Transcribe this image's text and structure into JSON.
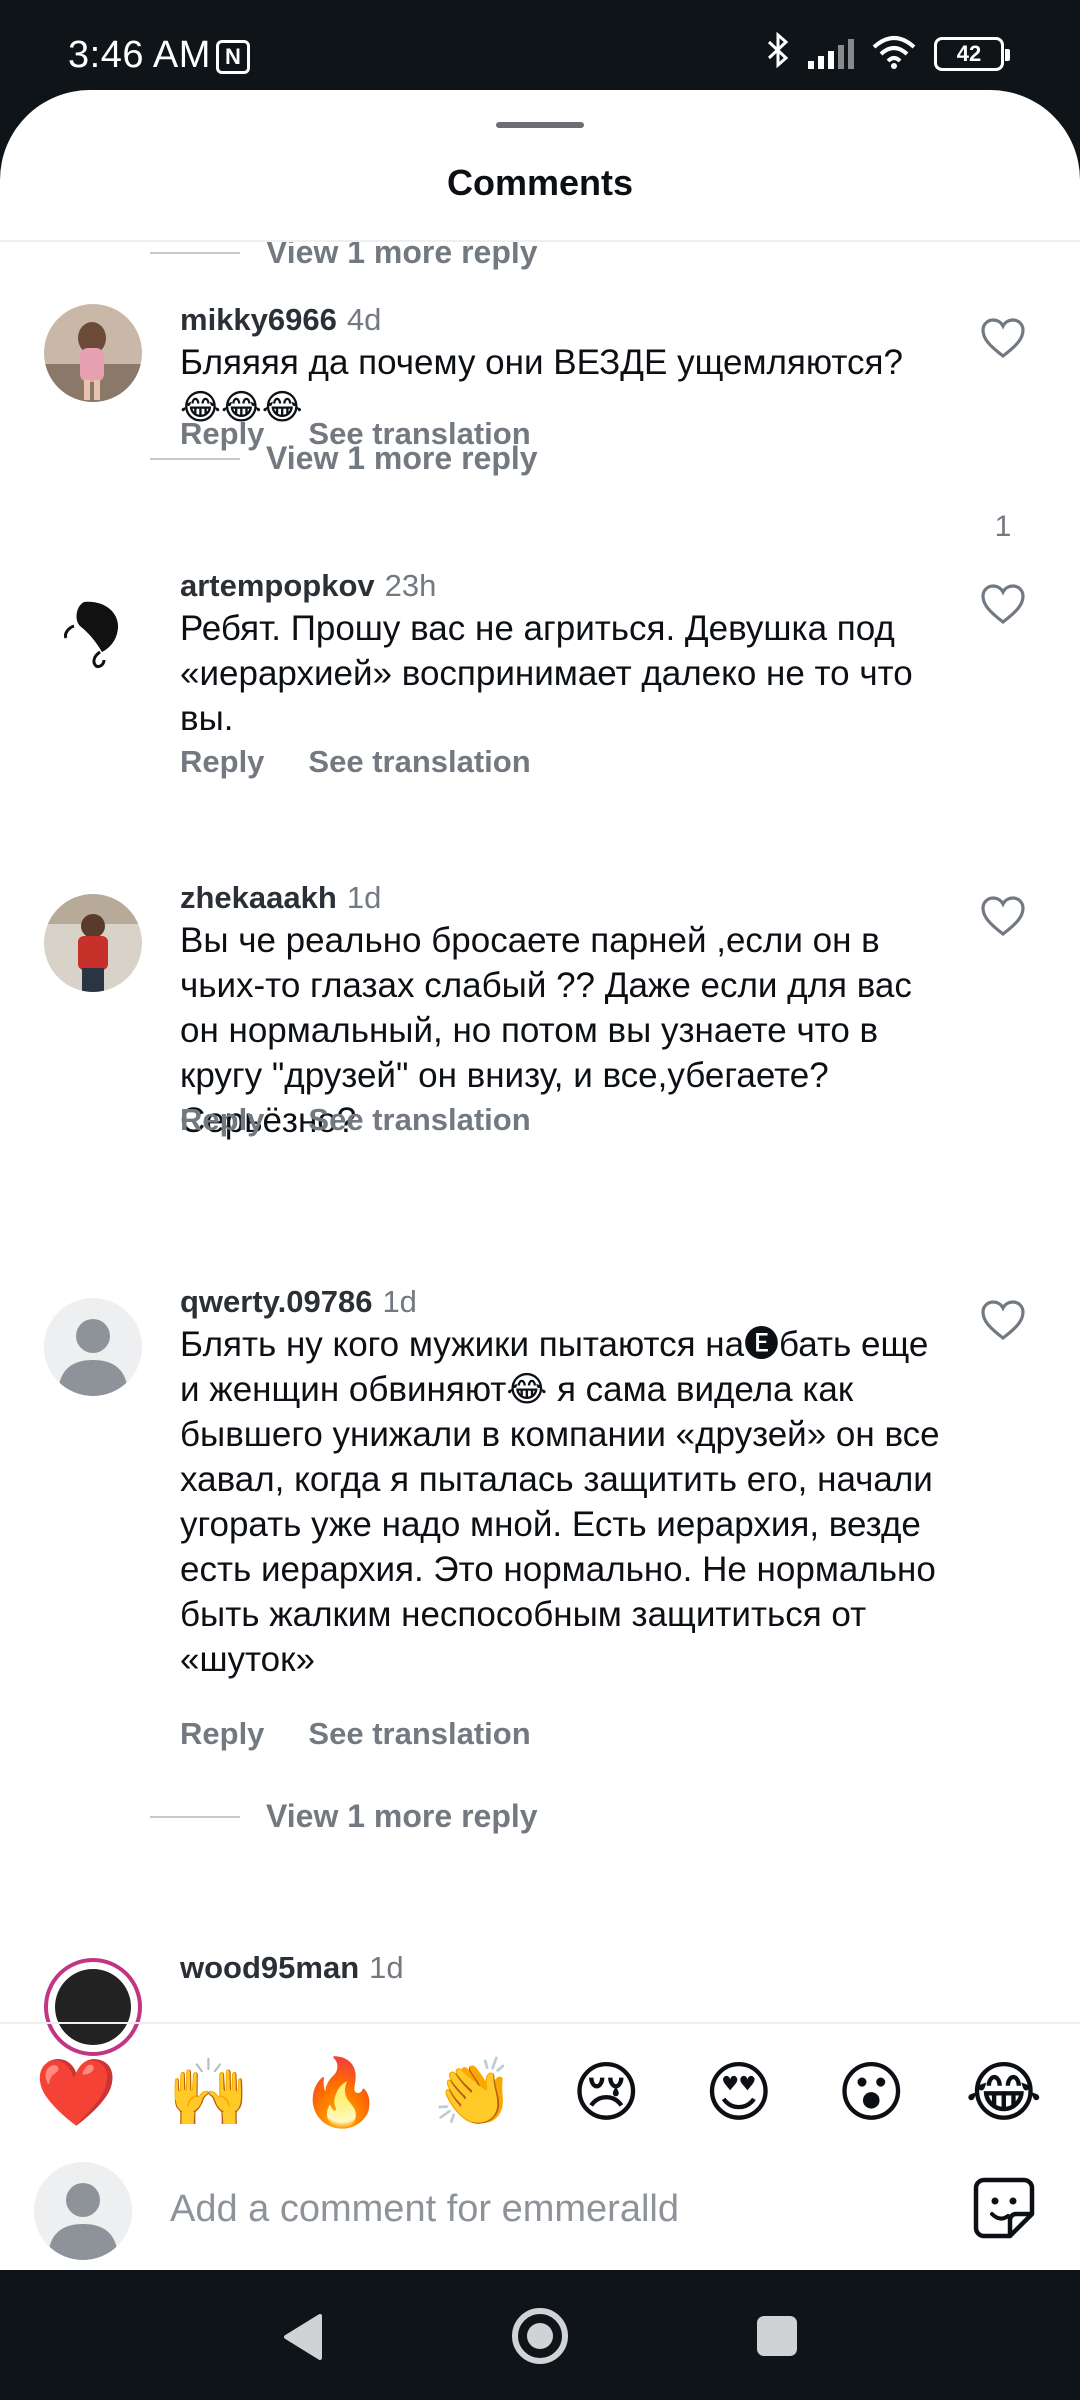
{
  "status_bar": {
    "time": "3:46 AM",
    "nfc_label": "N",
    "battery": "42",
    "icons": [
      "nfc-icon",
      "bluetooth-icon",
      "signal-icon",
      "wifi-icon",
      "battery-icon"
    ]
  },
  "sheet": {
    "title": "Comments"
  },
  "comments": [
    {
      "username": "mikky6966",
      "time": "4d",
      "text": "Бляяяя да почему они ВЕЗДЕ ущемляются? 😂😂😂",
      "likes": "1",
      "reply_label": "Reply",
      "translate_label": "See translation"
    },
    {
      "username": "artempopkov",
      "time": "23h",
      "text": "Ребят. Прошу вас не агриться. Девушка под «иерархией» воспринимает далеко не то что вы.",
      "likes": "",
      "reply_label": "Reply",
      "translate_label": "See translation"
    },
    {
      "username": "zhekaaakh",
      "time": "1d",
      "text": "Вы че реально бросаете парней ,если он в чьих-то глазах слабый ?? Даже если для вас он нормальный, но потом вы узнаете что в кругу \"друзей\" он внизу, и все,убегаете? Серьёзно?",
      "likes": "",
      "reply_label": "Reply",
      "translate_label": "See translation"
    },
    {
      "username": "qwerty.09786",
      "time": "1d",
      "text": "Блять ну кого мужики пытаются на🅔бать еще и женщин обвиняют😂 я сама видела как бывшего унижали в компании «друзей» он все хавал, когда я пыталась защитить его, начали угорать уже надо мной. Есть иерархия, везде есть иерархия. Это нормально. Не нормально быть жалким неспособным защититься от «шуток»",
      "likes": "",
      "reply_label": "Reply",
      "translate_label": "See translation"
    },
    {
      "username": "wood95man",
      "time": "1d"
    }
  ],
  "view_more_replies": {
    "label_top": "View 1 more reply",
    "label_1": "View 1 more reply",
    "label_2": "View 1 more reply"
  },
  "reactions": [
    "❤️",
    "🙌",
    "🔥",
    "👏",
    "😢",
    "😍",
    "😮",
    "😂"
  ],
  "comment_bar": {
    "placeholder": "Add a comment for emmeralld"
  },
  "colors": {
    "background": "#ffffff",
    "system_bar": "#0f1418",
    "secondary_text": "#737980",
    "primary_text": "#0c1014"
  }
}
